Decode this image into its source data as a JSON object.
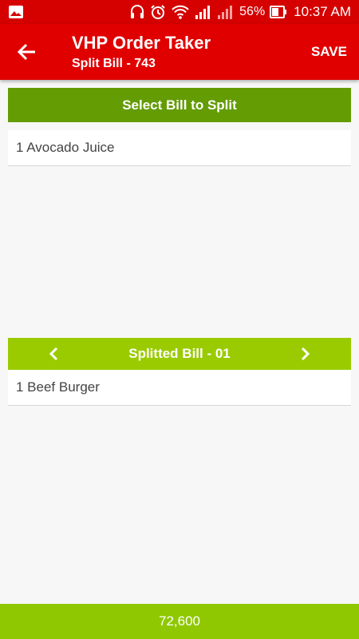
{
  "status_bar": {
    "battery_percent": "56%",
    "time": "10:37 AM",
    "icons": [
      "image-icon",
      "headset-icon",
      "alarm-icon",
      "wifi-icon",
      "signal-icon",
      "signal-icon",
      "battery-icon"
    ]
  },
  "app_bar": {
    "title": "VHP Order Taker",
    "subtitle": "Split Bill - 743",
    "save_label": "SAVE"
  },
  "select_section": {
    "header": "Select Bill to Split",
    "items": [
      {
        "label": "1 Avocado Juice"
      }
    ]
  },
  "split_section": {
    "header": "Splitted Bill - 01",
    "items": [
      {
        "label": "1 Beef Burger"
      }
    ]
  },
  "footer": {
    "total": "72,600"
  },
  "colors": {
    "status_bar": "#d50000",
    "app_bar": "#e00000",
    "select_header": "#649c04",
    "split_header": "#9acb00",
    "footer": "#8fc800"
  }
}
